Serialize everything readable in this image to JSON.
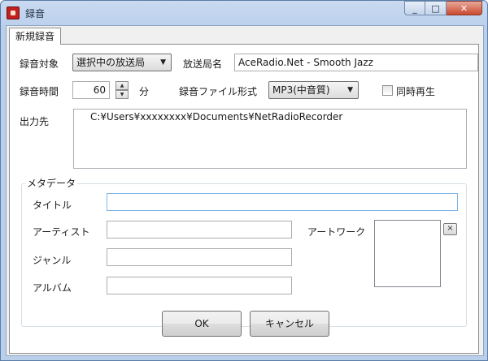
{
  "window": {
    "title": "録音",
    "icon": "recorder-app-icon"
  },
  "caption_buttons": {
    "minimize": "_",
    "maximize": "□",
    "close": "✕"
  },
  "tabs": [
    {
      "label": "新規録音",
      "active": true
    }
  ],
  "form": {
    "target_label": "録音対象",
    "target_value": "選択中の放送局",
    "station_label": "放送局名",
    "station_value": "AceRadio.Net - Smooth Jazz",
    "duration_label": "録音時間",
    "duration_value": "60",
    "duration_unit": "分",
    "format_label": "録音ファイル形式",
    "format_value": "MP3(中音質)",
    "simultaneous_label": "同時再生",
    "simultaneous_checked": false,
    "output_label": "出力先",
    "output_path": "C:¥Users¥xxxxxxxx¥Documents¥NetRadioRecorder"
  },
  "metadata": {
    "group_label": "メタデータ",
    "title_label": "タイトル",
    "title_value": "",
    "artist_label": "アーティスト",
    "artist_value": "",
    "genre_label": "ジャンル",
    "genre_value": "",
    "album_label": "アルバム",
    "album_value": "",
    "artwork_label": "アートワーク",
    "artwork_clear": "×"
  },
  "buttons": {
    "ok": "OK",
    "cancel": "キャンセル"
  }
}
